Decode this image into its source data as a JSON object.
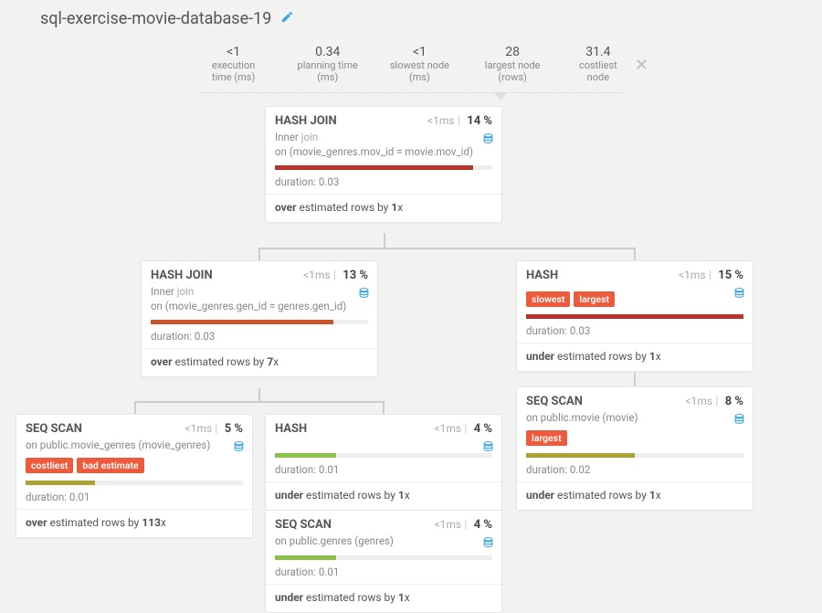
{
  "header": {
    "title": "sql-exercise-movie-database-19"
  },
  "stats": [
    {
      "val": "<1",
      "lbl": "execution time (ms)"
    },
    {
      "val": "0.34",
      "lbl": "planning time (ms)"
    },
    {
      "val": "<1",
      "lbl": "slowest node (ms)"
    },
    {
      "val": "28",
      "lbl": "largest node (rows)"
    },
    {
      "val": "31.4",
      "lbl": "costliest node"
    }
  ],
  "nodes": {
    "n1": {
      "name": "HASH JOIN",
      "time": "<1ms",
      "pct": "14 %",
      "subA": "Inner ",
      "subB": "join",
      "subC": "on (movie_genres.mov_id = movie.mov_id)",
      "dur": "duration: 0.03",
      "estA": "over",
      "estB": " estimated rows by ",
      "estC": "1",
      "estD": "x",
      "barClass": "bar-red",
      "barW": "91%"
    },
    "n2": {
      "name": "HASH JOIN",
      "time": "<1ms",
      "pct": "13 %",
      "subA": "Inner ",
      "subB": "join",
      "subC": "on (movie_genres.gen_id = genres.gen_id)",
      "dur": "duration: 0.03",
      "estA": "over",
      "estB": " estimated rows by ",
      "estC": "7",
      "estD": "x",
      "barClass": "bar-orange",
      "barW": "84%"
    },
    "n3": {
      "name": "HASH",
      "time": "<1ms",
      "pct": "15 %",
      "badge1": "slowest",
      "badge2": "largest",
      "dur": "duration: 0.03",
      "estA": "under",
      "estB": " estimated rows by ",
      "estC": "1",
      "estD": "x",
      "barClass": "bar-red",
      "barW": "100%"
    },
    "n4": {
      "name": "SEQ SCAN",
      "time": "<1ms",
      "pct": "5 %",
      "sub": "on public.movie_genres (movie_genres)",
      "badge1": "costliest",
      "badge2": "bad estimate",
      "dur": "duration: 0.01",
      "estA": "over",
      "estB": " estimated rows by ",
      "estC": "113",
      "estD": "x",
      "barClass": "bar-olive",
      "barW": "32%"
    },
    "n5": {
      "name": "HASH",
      "time": "<1ms",
      "pct": "4 %",
      "dur": "duration: 0.01",
      "estA": "under",
      "estB": " estimated rows by ",
      "estC": "1",
      "estD": "x",
      "barClass": "bar-green",
      "barW": "28%"
    },
    "n6": {
      "name": "SEQ SCAN",
      "time": "<1ms",
      "pct": "4 %",
      "sub": "on public.genres (genres)",
      "dur": "duration: 0.01",
      "estA": "under",
      "estB": " estimated rows by ",
      "estC": "1",
      "estD": "x",
      "barClass": "bar-green",
      "barW": "28%"
    },
    "n7": {
      "name": "SEQ SCAN",
      "time": "<1ms",
      "pct": "8 %",
      "sub": "on public.movie (movie)",
      "badge1": "largest",
      "dur": "duration: 0.02",
      "estA": "under",
      "estB": " estimated rows by ",
      "estC": "1",
      "estD": "x",
      "barClass": "bar-olive",
      "barW": "50%"
    }
  }
}
